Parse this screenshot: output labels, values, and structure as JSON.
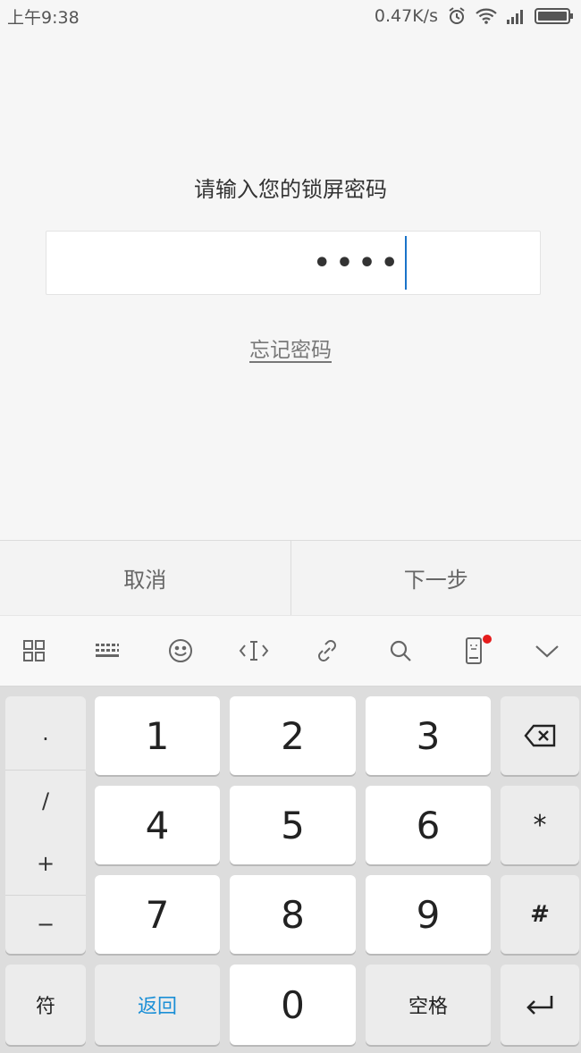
{
  "status_bar": {
    "time": "上午9:38",
    "speed": "0.47K/s",
    "icons": [
      "alarm-icon",
      "wifi-icon",
      "signal-icon",
      "battery-icon"
    ]
  },
  "prompt": "请输入您的锁屏密码",
  "password": {
    "masked_value": "••••"
  },
  "forgot_password": "忘记密码",
  "actions": {
    "cancel": "取消",
    "next": "下一步"
  },
  "keyboard_toolbar": {
    "icons": [
      "grid-icon",
      "keyboard-icon",
      "emoji-icon",
      "cursor-move-icon",
      "link-icon",
      "search-icon",
      "phone-icon",
      "chevron-down-icon"
    ],
    "notification_color": "#e51c1c"
  },
  "keyboard": {
    "symbols": [
      ".",
      "/",
      "+",
      "−"
    ],
    "digits": [
      "1",
      "2",
      "3",
      "4",
      "5",
      "6",
      "7",
      "8",
      "9",
      "0"
    ],
    "star": "*",
    "hash": "#",
    "fu": "符",
    "back": "返回",
    "space": "空格"
  },
  "colors": {
    "accent": "#1b8fd6",
    "caret": "#1a73c9"
  }
}
